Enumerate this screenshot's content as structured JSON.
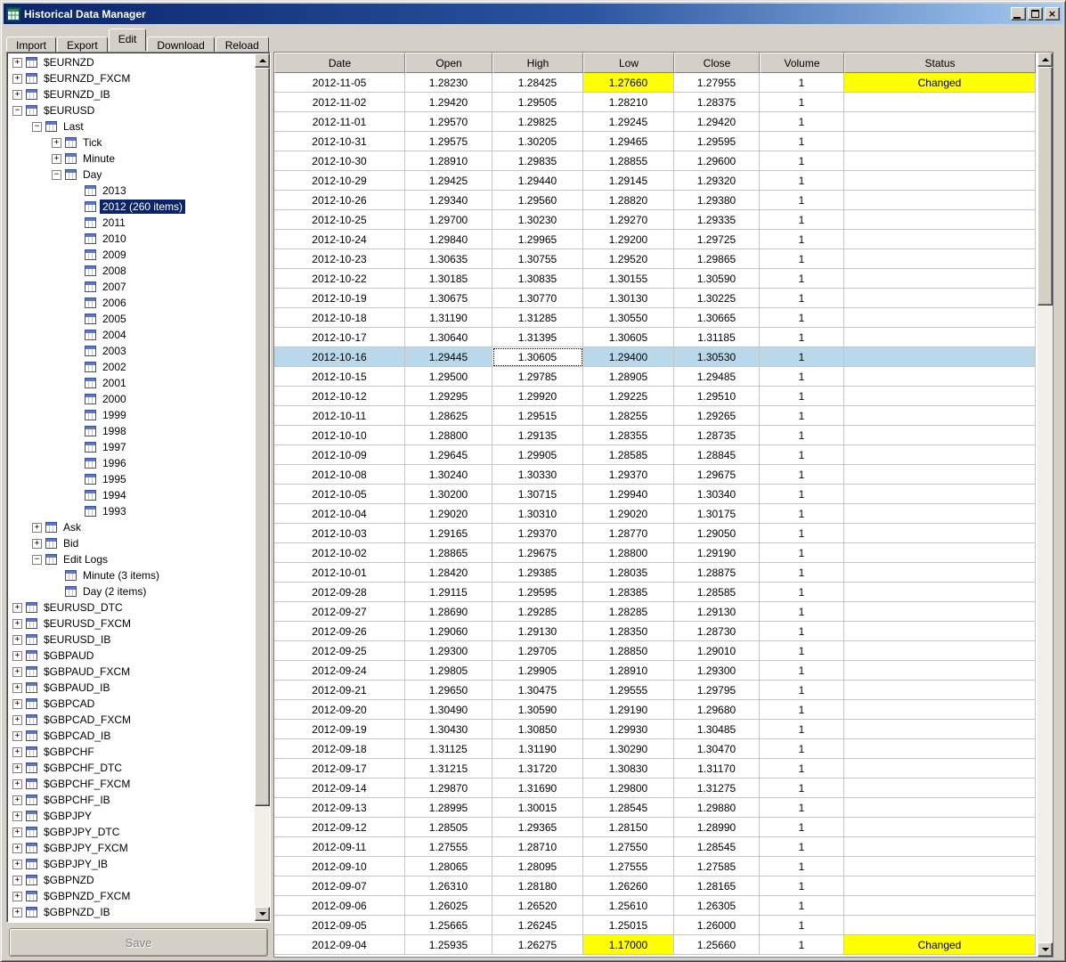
{
  "window": {
    "title": "Historical Data Manager",
    "controls": [
      "minimize",
      "maximize",
      "close"
    ]
  },
  "tabs": [
    {
      "label": "Import",
      "active": false
    },
    {
      "label": "Export",
      "active": false
    },
    {
      "label": "Edit",
      "active": true
    },
    {
      "label": "Download",
      "active": false
    },
    {
      "label": "Reload",
      "active": false
    }
  ],
  "tree": {
    "items": [
      {
        "lvl": 0,
        "exp": "+",
        "label": "$EURNZD"
      },
      {
        "lvl": 0,
        "exp": "+",
        "label": "$EURNZD_FXCM"
      },
      {
        "lvl": 0,
        "exp": "+",
        "label": "$EURNZD_IB"
      },
      {
        "lvl": 0,
        "exp": "-",
        "label": "$EURUSD"
      },
      {
        "lvl": 1,
        "exp": "-",
        "label": "Last"
      },
      {
        "lvl": 2,
        "exp": "+",
        "label": "Tick"
      },
      {
        "lvl": 2,
        "exp": "+",
        "label": "Minute"
      },
      {
        "lvl": 2,
        "exp": "-",
        "label": "Day"
      },
      {
        "lvl": 3,
        "exp": "",
        "label": "2013"
      },
      {
        "lvl": 3,
        "exp": "",
        "label": "2012 (260 items)",
        "selected": true
      },
      {
        "lvl": 3,
        "exp": "",
        "label": "2011"
      },
      {
        "lvl": 3,
        "exp": "",
        "label": "2010"
      },
      {
        "lvl": 3,
        "exp": "",
        "label": "2009"
      },
      {
        "lvl": 3,
        "exp": "",
        "label": "2008"
      },
      {
        "lvl": 3,
        "exp": "",
        "label": "2007"
      },
      {
        "lvl": 3,
        "exp": "",
        "label": "2006"
      },
      {
        "lvl": 3,
        "exp": "",
        "label": "2005"
      },
      {
        "lvl": 3,
        "exp": "",
        "label": "2004"
      },
      {
        "lvl": 3,
        "exp": "",
        "label": "2003"
      },
      {
        "lvl": 3,
        "exp": "",
        "label": "2002"
      },
      {
        "lvl": 3,
        "exp": "",
        "label": "2001"
      },
      {
        "lvl": 3,
        "exp": "",
        "label": "2000"
      },
      {
        "lvl": 3,
        "exp": "",
        "label": "1999"
      },
      {
        "lvl": 3,
        "exp": "",
        "label": "1998"
      },
      {
        "lvl": 3,
        "exp": "",
        "label": "1997"
      },
      {
        "lvl": 3,
        "exp": "",
        "label": "1996"
      },
      {
        "lvl": 3,
        "exp": "",
        "label": "1995"
      },
      {
        "lvl": 3,
        "exp": "",
        "label": "1994"
      },
      {
        "lvl": 3,
        "exp": "",
        "label": "1993"
      },
      {
        "lvl": 1,
        "exp": "+",
        "label": "Ask"
      },
      {
        "lvl": 1,
        "exp": "+",
        "label": "Bid"
      },
      {
        "lvl": 1,
        "exp": "-",
        "label": "Edit Logs"
      },
      {
        "lvl": 2,
        "exp": "",
        "label": "Minute (3 items)"
      },
      {
        "lvl": 2,
        "exp": "",
        "label": "Day (2 items)"
      },
      {
        "lvl": 0,
        "exp": "+",
        "label": "$EURUSD_DTC"
      },
      {
        "lvl": 0,
        "exp": "+",
        "label": "$EURUSD_FXCM"
      },
      {
        "lvl": 0,
        "exp": "+",
        "label": "$EURUSD_IB"
      },
      {
        "lvl": 0,
        "exp": "+",
        "label": "$GBPAUD"
      },
      {
        "lvl": 0,
        "exp": "+",
        "label": "$GBPAUD_FXCM"
      },
      {
        "lvl": 0,
        "exp": "+",
        "label": "$GBPAUD_IB"
      },
      {
        "lvl": 0,
        "exp": "+",
        "label": "$GBPCAD"
      },
      {
        "lvl": 0,
        "exp": "+",
        "label": "$GBPCAD_FXCM"
      },
      {
        "lvl": 0,
        "exp": "+",
        "label": "$GBPCAD_IB"
      },
      {
        "lvl": 0,
        "exp": "+",
        "label": "$GBPCHF"
      },
      {
        "lvl": 0,
        "exp": "+",
        "label": "$GBPCHF_DTC"
      },
      {
        "lvl": 0,
        "exp": "+",
        "label": "$GBPCHF_FXCM"
      },
      {
        "lvl": 0,
        "exp": "+",
        "label": "$GBPCHF_IB"
      },
      {
        "lvl": 0,
        "exp": "+",
        "label": "$GBPJPY"
      },
      {
        "lvl": 0,
        "exp": "+",
        "label": "$GBPJPY_DTC"
      },
      {
        "lvl": 0,
        "exp": "+",
        "label": "$GBPJPY_FXCM"
      },
      {
        "lvl": 0,
        "exp": "+",
        "label": "$GBPJPY_IB"
      },
      {
        "lvl": 0,
        "exp": "+",
        "label": "$GBPNZD"
      },
      {
        "lvl": 0,
        "exp": "+",
        "label": "$GBPNZD_FXCM"
      },
      {
        "lvl": 0,
        "exp": "+",
        "label": "$GBPNZD_IB"
      }
    ]
  },
  "save_button": {
    "label": "Save",
    "enabled": false
  },
  "table": {
    "columns": [
      "Date",
      "Open",
      "High",
      "Low",
      "Close",
      "Volume",
      "Status"
    ],
    "rows": [
      [
        "2012-11-05",
        "1.28230",
        "1.28425",
        "1.27660",
        "1.27955",
        "1",
        "Changed"
      ],
      [
        "2012-11-02",
        "1.29420",
        "1.29505",
        "1.28210",
        "1.28375",
        "1",
        ""
      ],
      [
        "2012-11-01",
        "1.29570",
        "1.29825",
        "1.29245",
        "1.29420",
        "1",
        ""
      ],
      [
        "2012-10-31",
        "1.29575",
        "1.30205",
        "1.29465",
        "1.29595",
        "1",
        ""
      ],
      [
        "2012-10-30",
        "1.28910",
        "1.29835",
        "1.28855",
        "1.29600",
        "1",
        ""
      ],
      [
        "2012-10-29",
        "1.29425",
        "1.29440",
        "1.29145",
        "1.29320",
        "1",
        ""
      ],
      [
        "2012-10-26",
        "1.29340",
        "1.29560",
        "1.28820",
        "1.29380",
        "1",
        ""
      ],
      [
        "2012-10-25",
        "1.29700",
        "1.30230",
        "1.29270",
        "1.29335",
        "1",
        ""
      ],
      [
        "2012-10-24",
        "1.29840",
        "1.29965",
        "1.29200",
        "1.29725",
        "1",
        ""
      ],
      [
        "2012-10-23",
        "1.30635",
        "1.30755",
        "1.29520",
        "1.29865",
        "1",
        ""
      ],
      [
        "2012-10-22",
        "1.30185",
        "1.30835",
        "1.30155",
        "1.30590",
        "1",
        ""
      ],
      [
        "2012-10-19",
        "1.30675",
        "1.30770",
        "1.30130",
        "1.30225",
        "1",
        ""
      ],
      [
        "2012-10-18",
        "1.31190",
        "1.31285",
        "1.30550",
        "1.30665",
        "1",
        ""
      ],
      [
        "2012-10-17",
        "1.30640",
        "1.31395",
        "1.30605",
        "1.31185",
        "1",
        ""
      ],
      [
        "2012-10-16",
        "1.29445",
        "1.30605",
        "1.29400",
        "1.30530",
        "1",
        ""
      ],
      [
        "2012-10-15",
        "1.29500",
        "1.29785",
        "1.28905",
        "1.29485",
        "1",
        ""
      ],
      [
        "2012-10-12",
        "1.29295",
        "1.29920",
        "1.29225",
        "1.29510",
        "1",
        ""
      ],
      [
        "2012-10-11",
        "1.28625",
        "1.29515",
        "1.28255",
        "1.29265",
        "1",
        ""
      ],
      [
        "2012-10-10",
        "1.28800",
        "1.29135",
        "1.28355",
        "1.28735",
        "1",
        ""
      ],
      [
        "2012-10-09",
        "1.29645",
        "1.29905",
        "1.28585",
        "1.28845",
        "1",
        ""
      ],
      [
        "2012-10-08",
        "1.30240",
        "1.30330",
        "1.29370",
        "1.29675",
        "1",
        ""
      ],
      [
        "2012-10-05",
        "1.30200",
        "1.30715",
        "1.29940",
        "1.30340",
        "1",
        ""
      ],
      [
        "2012-10-04",
        "1.29020",
        "1.30310",
        "1.29020",
        "1.30175",
        "1",
        ""
      ],
      [
        "2012-10-03",
        "1.29165",
        "1.29370",
        "1.28770",
        "1.29050",
        "1",
        ""
      ],
      [
        "2012-10-02",
        "1.28865",
        "1.29675",
        "1.28800",
        "1.29190",
        "1",
        ""
      ],
      [
        "2012-10-01",
        "1.28420",
        "1.29385",
        "1.28035",
        "1.28875",
        "1",
        ""
      ],
      [
        "2012-09-28",
        "1.29115",
        "1.29595",
        "1.28385",
        "1.28585",
        "1",
        ""
      ],
      [
        "2012-09-27",
        "1.28690",
        "1.29285",
        "1.28285",
        "1.29130",
        "1",
        ""
      ],
      [
        "2012-09-26",
        "1.29060",
        "1.29130",
        "1.28350",
        "1.28730",
        "1",
        ""
      ],
      [
        "2012-09-25",
        "1.29300",
        "1.29705",
        "1.28850",
        "1.29010",
        "1",
        ""
      ],
      [
        "2012-09-24",
        "1.29805",
        "1.29905",
        "1.28910",
        "1.29300",
        "1",
        ""
      ],
      [
        "2012-09-21",
        "1.29650",
        "1.30475",
        "1.29555",
        "1.29795",
        "1",
        ""
      ],
      [
        "2012-09-20",
        "1.30490",
        "1.30590",
        "1.29190",
        "1.29680",
        "1",
        ""
      ],
      [
        "2012-09-19",
        "1.30430",
        "1.30850",
        "1.29930",
        "1.30485",
        "1",
        ""
      ],
      [
        "2012-09-18",
        "1.31125",
        "1.31190",
        "1.30290",
        "1.30470",
        "1",
        ""
      ],
      [
        "2012-09-17",
        "1.31215",
        "1.31720",
        "1.30830",
        "1.31170",
        "1",
        ""
      ],
      [
        "2012-09-14",
        "1.29870",
        "1.31690",
        "1.29800",
        "1.31275",
        "1",
        ""
      ],
      [
        "2012-09-13",
        "1.28995",
        "1.30015",
        "1.28545",
        "1.29880",
        "1",
        ""
      ],
      [
        "2012-09-12",
        "1.28505",
        "1.29365",
        "1.28150",
        "1.28990",
        "1",
        ""
      ],
      [
        "2012-09-11",
        "1.27555",
        "1.28710",
        "1.27550",
        "1.28545",
        "1",
        ""
      ],
      [
        "2012-09-10",
        "1.28065",
        "1.28095",
        "1.27555",
        "1.27585",
        "1",
        ""
      ],
      [
        "2012-09-07",
        "1.26310",
        "1.28180",
        "1.26260",
        "1.28165",
        "1",
        ""
      ],
      [
        "2012-09-06",
        "1.26025",
        "1.26520",
        "1.25610",
        "1.26305",
        "1",
        ""
      ],
      [
        "2012-09-05",
        "1.25665",
        "1.26245",
        "1.25015",
        "1.26000",
        "1",
        ""
      ],
      [
        "2012-09-04",
        "1.25935",
        "1.26275",
        "1.17000",
        "1.25660",
        "1",
        "Changed"
      ]
    ],
    "selected_row_index": 14,
    "focus_cell": {
      "row": 14,
      "col": 2
    },
    "yellow_cells": [
      [
        0,
        3
      ],
      [
        0,
        6
      ],
      [
        44,
        3
      ],
      [
        44,
        6
      ]
    ]
  },
  "colors": {
    "titlebar_gradient_start": "#0a246a",
    "titlebar_gradient_end": "#a6caf0",
    "chrome": "#d4d0c8",
    "tree_selection": "#0a246a",
    "row_selection": "#b9d9ea",
    "changed_highlight": "#ffff00"
  }
}
